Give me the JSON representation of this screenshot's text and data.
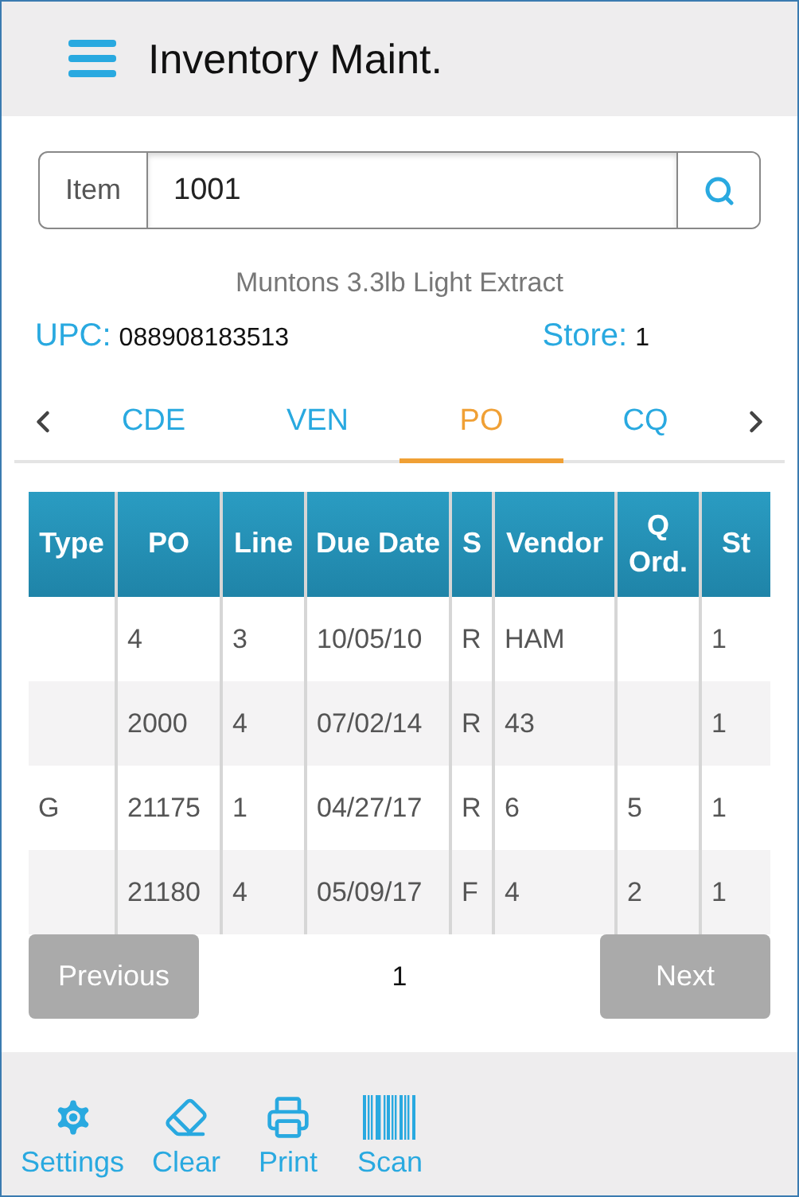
{
  "header": {
    "title": "Inventory Maint."
  },
  "search": {
    "label": "Item",
    "value": "1001"
  },
  "product": {
    "name": "Muntons 3.3lb Light Extract",
    "upc_label": "UPC:",
    "upc": "088908183513",
    "store_label": "Store:",
    "store": "1"
  },
  "tabs": [
    {
      "label": "CDE",
      "selected": false
    },
    {
      "label": "VEN",
      "selected": false
    },
    {
      "label": "PO",
      "selected": true
    },
    {
      "label": "CQ",
      "selected": false
    }
  ],
  "table": {
    "columns": [
      "Type",
      "PO",
      "Line",
      "Due Date",
      "S",
      "Vendor",
      "Q Ord.",
      "St"
    ],
    "rows": [
      [
        null,
        "4",
        "3",
        "10/05/10",
        "R",
        "HAM",
        null,
        "1"
      ],
      [
        null,
        "2000",
        "4",
        "07/02/14",
        "R",
        "43",
        null,
        "1"
      ],
      [
        "G",
        "21175",
        "1",
        "04/27/17",
        "R",
        "6",
        "5",
        "1"
      ],
      [
        null,
        "21180",
        "4",
        "05/09/17",
        "F",
        "4",
        "2",
        "1"
      ]
    ]
  },
  "pagination": {
    "previous": "Previous",
    "page": "1",
    "next": "Next"
  },
  "toolbar": [
    {
      "kind": "settings",
      "label": "Settings"
    },
    {
      "kind": "clear",
      "label": "Clear"
    },
    {
      "kind": "print",
      "label": "Print"
    },
    {
      "kind": "scan",
      "label": "Scan"
    }
  ]
}
